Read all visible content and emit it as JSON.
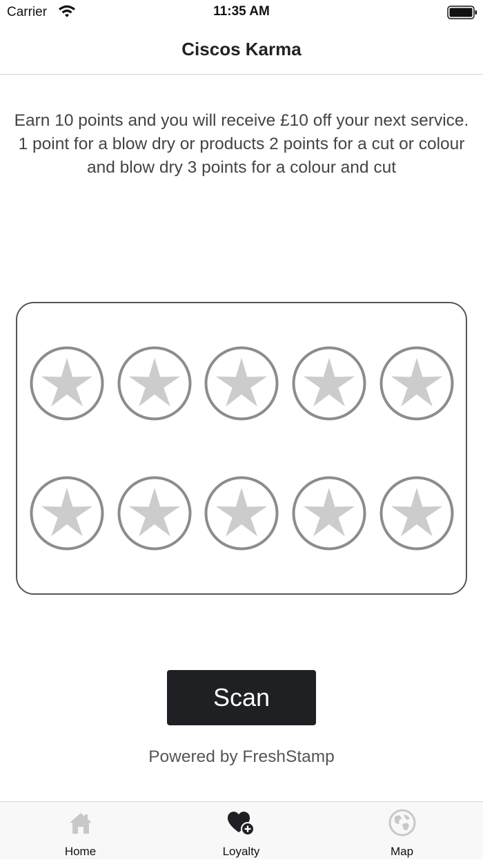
{
  "status_bar": {
    "carrier": "Carrier",
    "time": "11:35 AM"
  },
  "nav": {
    "title": "Ciscos Karma"
  },
  "description": {
    "line1": "Earn 10 points and you will receive £10 off your next service.",
    "line2": "1 point for a blow dry or products 2 points for a cut or colour and blow dry 3 points for a colour and cut"
  },
  "stamp_card": {
    "total_stamps": 10,
    "earned_stamps": 0,
    "stamp_icon": "star-icon",
    "stamp_color": "#cccccc",
    "ring_color": "#8c8c8c"
  },
  "scan_button": {
    "label": "Scan"
  },
  "powered_by": "Powered by FreshStamp",
  "tab_bar": {
    "items": [
      {
        "label": "Home",
        "icon": "home-icon",
        "active": false
      },
      {
        "label": "Loyalty",
        "icon": "heart-plus-icon",
        "active": true
      },
      {
        "label": "Map",
        "icon": "globe-icon",
        "active": false
      }
    ]
  }
}
